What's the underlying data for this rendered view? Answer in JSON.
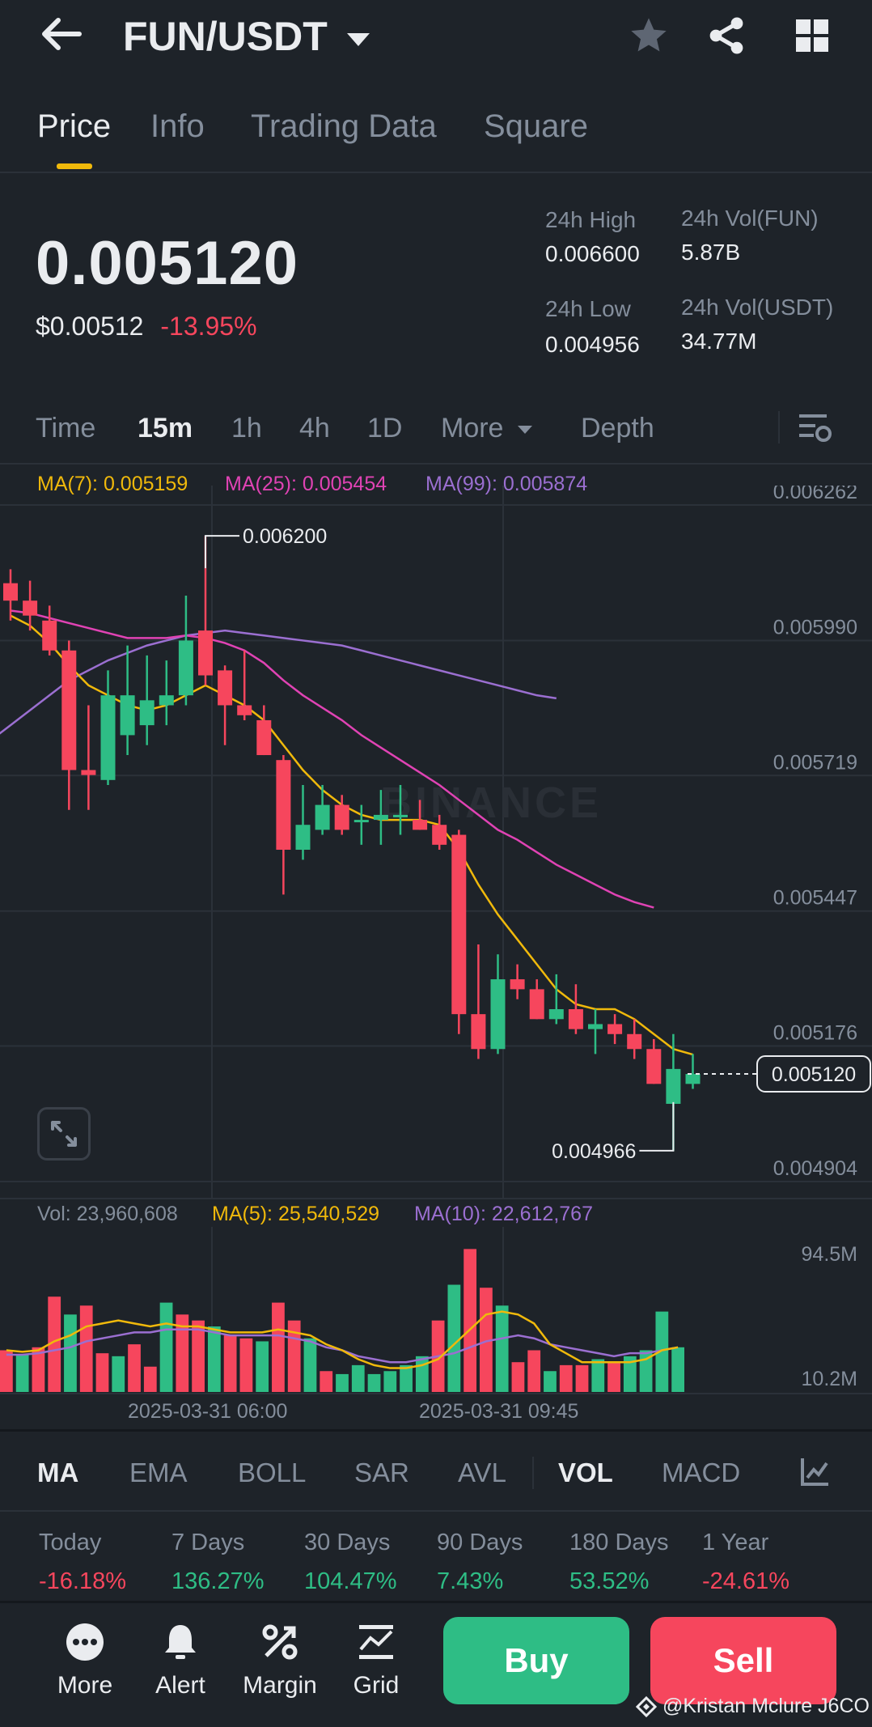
{
  "header": {
    "pair": "FUN/USDT",
    "back_icon": "arrow-left-icon",
    "star_icon": "star-icon",
    "share_icon": "share-icon",
    "grid_icon": "grid-icon"
  },
  "tabs": [
    {
      "label": "Price",
      "active": true
    },
    {
      "label": "Info"
    },
    {
      "label": "Trading Data"
    },
    {
      "label": "Square"
    }
  ],
  "ticker": {
    "price": "0.005120",
    "usd_price": "$0.00512",
    "change": "-13.95%",
    "high_label": "24h High",
    "high": "0.006600",
    "low_label": "24h Low",
    "low": "0.004956",
    "vol_fun_label": "24h Vol(FUN)",
    "vol_fun": "5.87B",
    "vol_usdt_label": "24h Vol(USDT)",
    "vol_usdt": "34.77M"
  },
  "timeframes": [
    "Time",
    "15m",
    "1h",
    "4h",
    "1D",
    "More",
    "Depth"
  ],
  "timeframe_active": "15m",
  "colors": {
    "up": "#2ebd85",
    "down": "#f6465d",
    "ma7": "#f0b90b",
    "ma25": "#e043b4",
    "ma99": "#9b6fd1"
  },
  "chart_data": {
    "type": "candlestick",
    "ma": {
      "ma7": "MA(7): 0.005159",
      "ma25": "MA(25): 0.005454",
      "ma99": "MA(99): 0.005874"
    },
    "y_ticks": [
      "0.006262",
      "0.005990",
      "0.005719",
      "0.005447",
      "0.005176",
      "0.004904"
    ],
    "y_tick_values": [
      0.006262,
      0.00599,
      0.005719,
      0.005447,
      0.005176,
      0.004904
    ],
    "ylim": [
      0.004904,
      0.006262
    ],
    "high_marker": "0.006200",
    "high_marker_value": 0.0062,
    "low_marker": "0.004966",
    "low_marker_value": 0.004966,
    "current_price_label": "0.005120",
    "current_price_value": 0.00512,
    "x_labels": [
      "2025-03-31 06:00",
      "2025-03-31 09:45"
    ],
    "candles": [
      {
        "o": 0.006105,
        "h": 0.006133,
        "l": 0.00603,
        "c": 0.00607
      },
      {
        "o": 0.00607,
        "h": 0.00611,
        "l": 0.00601,
        "c": 0.00604
      },
      {
        "o": 0.00603,
        "h": 0.00606,
        "l": 0.00596,
        "c": 0.00597
      },
      {
        "o": 0.00597,
        "h": 0.00599,
        "l": 0.00565,
        "c": 0.00573
      },
      {
        "o": 0.00573,
        "h": 0.00586,
        "l": 0.00565,
        "c": 0.00572
      },
      {
        "o": 0.00571,
        "h": 0.00593,
        "l": 0.0057,
        "c": 0.00588
      },
      {
        "o": 0.0058,
        "h": 0.00598,
        "l": 0.00576,
        "c": 0.00588
      },
      {
        "o": 0.00582,
        "h": 0.00596,
        "l": 0.00578,
        "c": 0.00587
      },
      {
        "o": 0.00586,
        "h": 0.00595,
        "l": 0.00582,
        "c": 0.00588
      },
      {
        "o": 0.00588,
        "h": 0.00608,
        "l": 0.00586,
        "c": 0.00599
      },
      {
        "o": 0.00601,
        "h": 0.0062,
        "l": 0.0059,
        "c": 0.00592
      },
      {
        "o": 0.00593,
        "h": 0.00594,
        "l": 0.00578,
        "c": 0.00586
      },
      {
        "o": 0.00586,
        "h": 0.00597,
        "l": 0.00583,
        "c": 0.00584
      },
      {
        "o": 0.00583,
        "h": 0.00586,
        "l": 0.00576,
        "c": 0.00576
      },
      {
        "o": 0.00575,
        "h": 0.00576,
        "l": 0.00548,
        "c": 0.00557
      },
      {
        "o": 0.00557,
        "h": 0.0057,
        "l": 0.00555,
        "c": 0.00562
      },
      {
        "o": 0.00561,
        "h": 0.0057,
        "l": 0.0056,
        "c": 0.00566
      },
      {
        "o": 0.00566,
        "h": 0.00568,
        "l": 0.0056,
        "c": 0.00561
      },
      {
        "o": 0.00563,
        "h": 0.00566,
        "l": 0.00558,
        "c": 0.00563
      },
      {
        "o": 0.00563,
        "h": 0.00569,
        "l": 0.00558,
        "c": 0.00564
      },
      {
        "o": 0.00564,
        "h": 0.0057,
        "l": 0.0056,
        "c": 0.00564
      },
      {
        "o": 0.00563,
        "h": 0.00567,
        "l": 0.00561,
        "c": 0.00561
      },
      {
        "o": 0.00562,
        "h": 0.00564,
        "l": 0.00557,
        "c": 0.00558
      },
      {
        "o": 0.0056,
        "h": 0.00561,
        "l": 0.0052,
        "c": 0.00524
      },
      {
        "o": 0.00524,
        "h": 0.00538,
        "l": 0.00515,
        "c": 0.00517
      },
      {
        "o": 0.00517,
        "h": 0.00536,
        "l": 0.00516,
        "c": 0.00531
      },
      {
        "o": 0.00531,
        "h": 0.00534,
        "l": 0.00527,
        "c": 0.00529
      },
      {
        "o": 0.00529,
        "h": 0.00531,
        "l": 0.00523,
        "c": 0.00523
      },
      {
        "o": 0.00523,
        "h": 0.00532,
        "l": 0.00522,
        "c": 0.00525
      },
      {
        "o": 0.00525,
        "h": 0.0053,
        "l": 0.0052,
        "c": 0.00521
      },
      {
        "o": 0.00521,
        "h": 0.00525,
        "l": 0.00516,
        "c": 0.00522
      },
      {
        "o": 0.00522,
        "h": 0.00524,
        "l": 0.00518,
        "c": 0.0052
      },
      {
        "o": 0.0052,
        "h": 0.00523,
        "l": 0.00515,
        "c": 0.00517
      },
      {
        "o": 0.00517,
        "h": 0.00519,
        "l": 0.0051,
        "c": 0.0051
      },
      {
        "o": 0.00506,
        "h": 0.0052,
        "l": 0.004966,
        "c": 0.00513
      },
      {
        "o": 0.0051,
        "h": 0.00516,
        "l": 0.00509,
        "c": 0.00512
      }
    ],
    "ma7_series": [
      0.00604,
      0.00602,
      0.005985,
      0.00594,
      0.0059,
      0.00588,
      0.00586,
      0.00585,
      0.00586,
      0.00588,
      0.0059,
      0.00588,
      0.00586,
      0.00583,
      0.00578,
      0.00573,
      0.00569,
      0.00566,
      0.00564,
      0.00563,
      0.00563,
      0.00563,
      0.00562,
      0.00557,
      0.0055,
      0.00544,
      0.00539,
      0.00534,
      0.00529,
      0.00526,
      0.00525,
      0.00525,
      0.00523,
      0.0052,
      0.00517,
      0.005159
    ],
    "ma25_series": [
      0.00605,
      0.006045,
      0.006035,
      0.006025,
      0.006015,
      0.006005,
      0.005995,
      0.005995,
      0.005995,
      0.006,
      0.005995,
      0.005985,
      0.00597,
      0.005945,
      0.00591,
      0.00588,
      0.005855,
      0.00583,
      0.0058,
      0.005775,
      0.00575,
      0.005725,
      0.0057,
      0.00567,
      0.00564,
      0.00561,
      0.00559,
      0.005565,
      0.00554,
      0.00552,
      0.0055,
      0.00548,
      0.005465,
      0.005454
    ],
    "ma99_series": [
      0.00576,
      0.00579,
      0.00582,
      0.00585,
      0.00588,
      0.00591,
      0.00593,
      0.00595,
      0.005965,
      0.00598,
      0.00599,
      0.006,
      0.006005,
      0.00601,
      0.006005,
      0.006,
      0.005995,
      0.00599,
      0.005985,
      0.00598,
      0.00597,
      0.00596,
      0.00595,
      0.00594,
      0.00593,
      0.00592,
      0.00591,
      0.0059,
      0.00589,
      0.00588,
      0.005874
    ],
    "volume": {
      "vol_label": "Vol: 23,960,608",
      "ma5_label": "MA(5): 25,540,529",
      "ma10_label": "MA(10): 22,612,767",
      "y_ticks": [
        "94.5M",
        "10.2M"
      ],
      "ylim": [
        0,
        100
      ],
      "bars_m": [
        28,
        25,
        30,
        64,
        52,
        58,
        26,
        24,
        32,
        17,
        60,
        52,
        48,
        44,
        38,
        36,
        34,
        60,
        48,
        36,
        14,
        12,
        18,
        12,
        14,
        18,
        24,
        48,
        72,
        96,
        70,
        58,
        20,
        28,
        14,
        18,
        18,
        22,
        20,
        24,
        28,
        54,
        30
      ],
      "ma5_m": [
        28,
        27,
        28,
        34,
        38,
        44,
        46,
        48,
        46,
        44,
        46,
        44,
        44,
        42,
        40,
        40,
        40,
        42,
        40,
        38,
        32,
        28,
        22,
        18,
        16,
        16,
        18,
        22,
        32,
        42,
        52,
        54,
        52,
        46,
        32,
        26,
        20,
        20,
        20,
        20,
        22,
        28,
        30
      ],
      "ma10_m": [
        25,
        25,
        26,
        28,
        30,
        34,
        36,
        38,
        40,
        40,
        42,
        42,
        42,
        40,
        38,
        38,
        38,
        38,
        36,
        34,
        30,
        28,
        24,
        22,
        20,
        20,
        22,
        24,
        26,
        30,
        34,
        36,
        38,
        36,
        32,
        30,
        28,
        26,
        24,
        26,
        26,
        28,
        30
      ]
    }
  },
  "indicators": [
    "MA",
    "EMA",
    "BOLL",
    "SAR",
    "AVL",
    "VOL",
    "MACD"
  ],
  "indicators_active": [
    "MA",
    "VOL"
  ],
  "performance": [
    {
      "label": "Today",
      "value": "-16.18%",
      "dir": "down"
    },
    {
      "label": "7 Days",
      "value": "136.27%",
      "dir": "up"
    },
    {
      "label": "30 Days",
      "value": "104.47%",
      "dir": "up"
    },
    {
      "label": "90 Days",
      "value": "7.43%",
      "dir": "up"
    },
    {
      "label": "180 Days",
      "value": "53.52%",
      "dir": "up"
    },
    {
      "label": "1 Year",
      "value": "-24.61%",
      "dir": "down"
    }
  ],
  "bottom_nav": [
    {
      "label": "More",
      "icon": "more-dots-icon"
    },
    {
      "label": "Alert",
      "icon": "bell-icon"
    },
    {
      "label": "Margin",
      "icon": "percent-icon"
    },
    {
      "label": "Grid",
      "icon": "grid-chart-icon"
    }
  ],
  "actions": {
    "buy": "Buy",
    "sell": "Sell"
  },
  "watermark": "@Kristan Mclure J6CO"
}
